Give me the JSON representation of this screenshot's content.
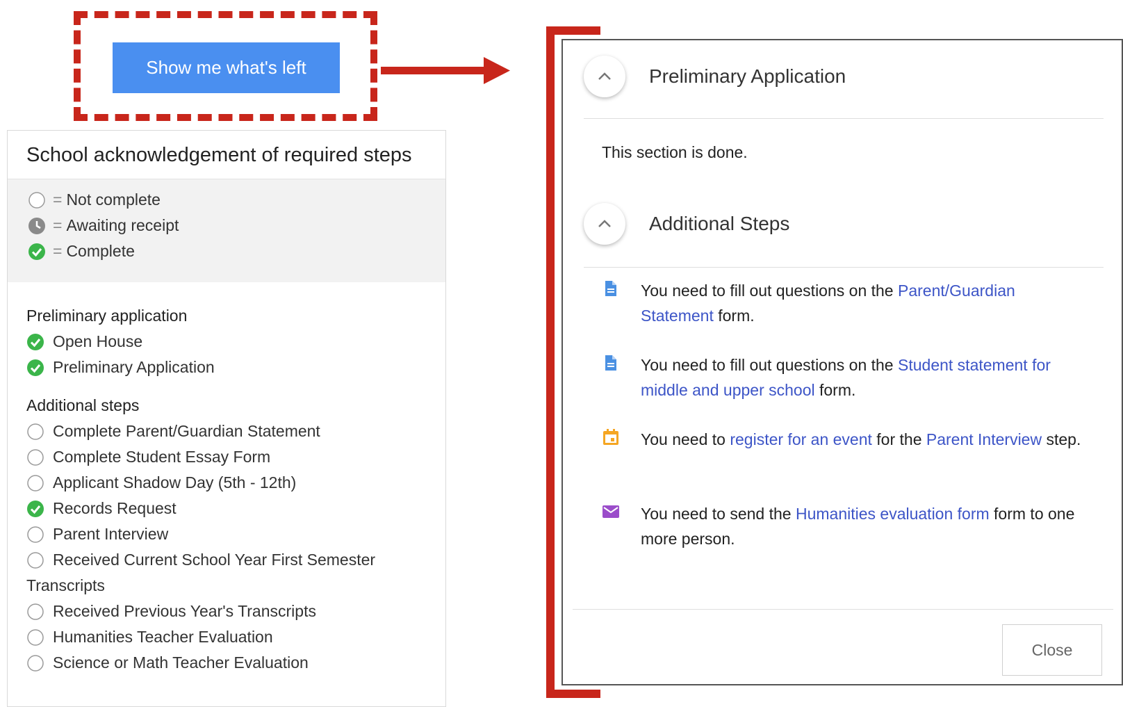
{
  "show_button": {
    "label": "Show me what's left"
  },
  "left_panel": {
    "title": "School acknowledgement of required steps",
    "legend": [
      {
        "icon": "empty-circle-icon",
        "eq": "=",
        "label": "Not complete"
      },
      {
        "icon": "clock-icon",
        "eq": "=",
        "label": "Awaiting receipt"
      },
      {
        "icon": "check-circle-icon",
        "eq": "=",
        "label": "Complete"
      }
    ],
    "groups": [
      {
        "title": "Preliminary application",
        "items": [
          {
            "status": "complete",
            "label": "Open House"
          },
          {
            "status": "complete",
            "label": "Preliminary Application"
          }
        ]
      },
      {
        "title": "Additional steps",
        "items": [
          {
            "status": "not-complete",
            "label": "Complete Parent/Guardian Statement"
          },
          {
            "status": "not-complete",
            "label": "Complete Student Essay Form"
          },
          {
            "status": "not-complete",
            "label": "Applicant Shadow Day (5th - 12th)"
          },
          {
            "status": "complete",
            "label": "Records Request"
          },
          {
            "status": "not-complete",
            "label": "Parent Interview"
          },
          {
            "status": "not-complete",
            "label": "Received Current School Year First Semester",
            "wrap": "Transcripts"
          },
          {
            "status": "not-complete",
            "label": "Received Previous Year's Transcripts"
          },
          {
            "status": "not-complete",
            "label": "Humanities Teacher Evaluation"
          },
          {
            "status": "not-complete",
            "label": "Science or Math Teacher Evaluation"
          }
        ]
      }
    ]
  },
  "modal": {
    "section1": {
      "title": "Preliminary Application",
      "done_text": "This section is done."
    },
    "section2": {
      "title": "Additional Steps"
    },
    "requirements": [
      {
        "icon": "document-icon",
        "parts": [
          {
            "text": "You need to fill out questions on the ",
            "link": false
          },
          {
            "text": "Parent/Guardian Statement",
            "link": true
          },
          {
            "text": " form.",
            "link": false
          }
        ]
      },
      {
        "icon": "document-icon",
        "parts": [
          {
            "text": "You need to fill out questions on the ",
            "link": false
          },
          {
            "text": "Student statement for middle and upper school",
            "link": true
          },
          {
            "text": " form.",
            "link": false
          }
        ]
      },
      {
        "icon": "calendar-icon",
        "parts": [
          {
            "text": "You need to ",
            "link": false
          },
          {
            "text": "register for an event",
            "link": true
          },
          {
            "text": " for the ",
            "link": false
          },
          {
            "text": "Parent Interview",
            "link": true
          },
          {
            "text": " step.",
            "link": false
          }
        ]
      },
      {
        "icon": "envelope-icon",
        "parts": [
          {
            "text": "You need to send the ",
            "link": false
          },
          {
            "text": "Humanities evaluation form",
            "link": true
          },
          {
            "text": " form to one more person.",
            "link": false
          }
        ]
      }
    ],
    "close_label": "Close"
  },
  "colors": {
    "accent_red": "#c8261b",
    "button_blue": "#4a8ff0",
    "link_blue": "#3d55c7",
    "complete_green": "#3bb54a",
    "doc_blue": "#4a90e2",
    "calendar_orange": "#f5a623",
    "envelope_purple": "#9b4dca"
  }
}
